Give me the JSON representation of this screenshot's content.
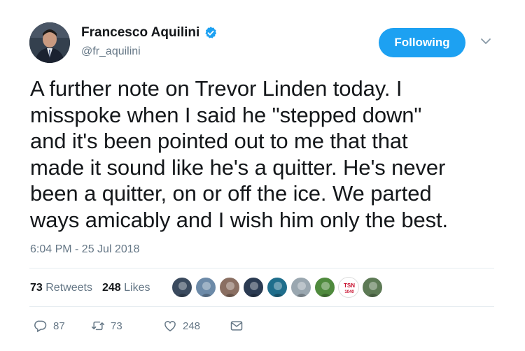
{
  "author": {
    "name": "Francesco Aquilini",
    "handle": "@fr_aquilini",
    "verified_icon": "verified-badge-icon"
  },
  "follow_button": {
    "label": "Following"
  },
  "tweet": {
    "lines": [
      "A further note on Trevor Linden today. I",
      "misspoke when I said he \"stepped down\"",
      "and it's been pointed out to me that that",
      "made it sound like he's a quitter. He's never",
      "been a quitter, on or off the ice. We parted",
      "ways amicably and I wish him only the best."
    ],
    "timestamp": "6:04 PM - 25 Jul 2018"
  },
  "stats": {
    "retweets_count": "73",
    "retweets_label": "Retweets",
    "likes_count": "248",
    "likes_label": "Likes"
  },
  "likers": [
    {
      "name": "liker-avatar-1",
      "color": "#3a4a5e"
    },
    {
      "name": "liker-avatar-2",
      "color": "#6c8aa8"
    },
    {
      "name": "liker-avatar-3",
      "color": "#8a6f62"
    },
    {
      "name": "liker-avatar-4",
      "color": "#2b3b52"
    },
    {
      "name": "liker-avatar-5",
      "color": "#1f6e8c"
    },
    {
      "name": "liker-avatar-6",
      "color": "#9aa7b0"
    },
    {
      "name": "liker-avatar-7",
      "color": "#4f8a3d"
    },
    {
      "name": "liker-avatar-tsn",
      "color": "#ffffff"
    },
    {
      "name": "liker-avatar-9",
      "color": "#5d7a55"
    }
  ],
  "actions": {
    "reply_count": "87",
    "retweet_count": "73",
    "like_count": "248"
  },
  "colors": {
    "accent": "#1da1f2",
    "secondary_text": "#657786",
    "divider": "#e6ecf0"
  }
}
